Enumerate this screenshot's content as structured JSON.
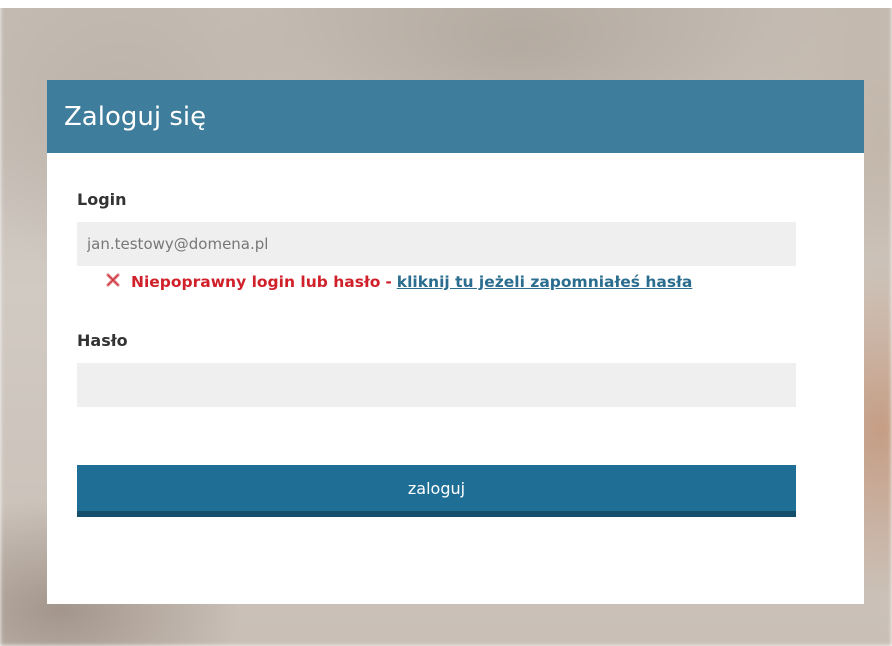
{
  "login_form": {
    "title": "Zaloguj się",
    "login": {
      "label": "Login",
      "value": "jan.testowy@domena.pl"
    },
    "error": {
      "message": "Niepoprawny login lub hasło",
      "separator": "-",
      "link_text": "kliknij tu jeżeli zapomniałeś hasła",
      "icon": "error-x-icon"
    },
    "password": {
      "label": "Hasło",
      "value": ""
    },
    "submit_label": "zaloguj"
  },
  "colors": {
    "header_bg": "#3f7d9c",
    "button_bg": "#1f6e96",
    "button_border": "#144f6b",
    "error_text": "#d0212b",
    "link_text": "#2a6d8f",
    "field_bg": "#efefef"
  }
}
